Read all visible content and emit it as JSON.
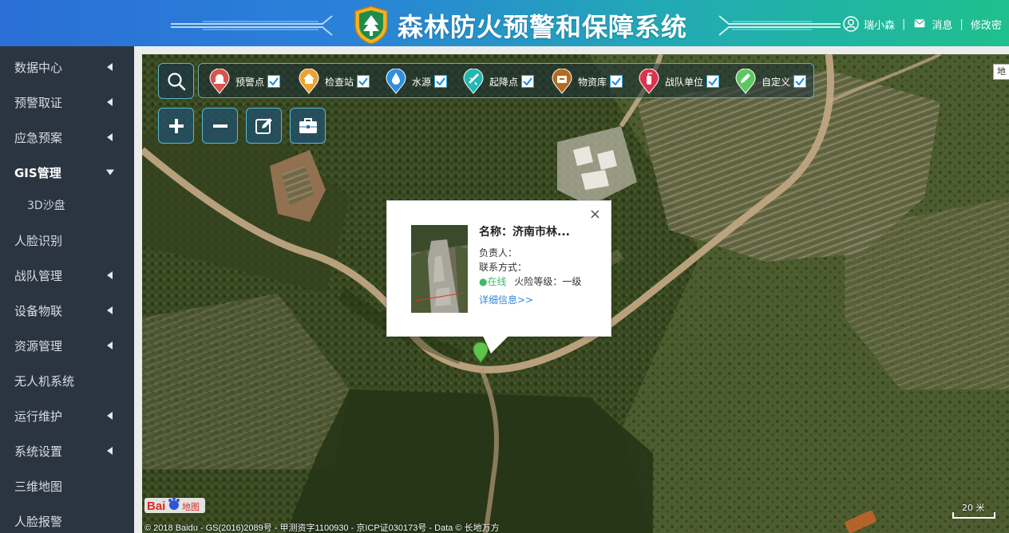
{
  "header": {
    "title": "森林防火预警和保障系统",
    "user_name": "瑞小森",
    "messages_label": "消息",
    "change_pwd_label": "修改密"
  },
  "sidebar": {
    "items": [
      {
        "label": "数据中心",
        "expandable": true
      },
      {
        "label": "预警取证",
        "expandable": true
      },
      {
        "label": "应急预案",
        "expandable": true
      },
      {
        "label": "GIS管理",
        "expandable": true,
        "open": true
      },
      {
        "label": "人脸识别",
        "expandable": false
      },
      {
        "label": "战队管理",
        "expandable": true
      },
      {
        "label": "设备物联",
        "expandable": true
      },
      {
        "label": "资源管理",
        "expandable": true
      },
      {
        "label": "无人机系统",
        "expandable": false
      },
      {
        "label": "运行维护",
        "expandable": true
      },
      {
        "label": "系统设置",
        "expandable": true
      },
      {
        "label": "三维地图",
        "expandable": false
      },
      {
        "label": "人脸报警",
        "expandable": false
      }
    ],
    "sub_items": [
      {
        "label": "3D沙盘"
      }
    ]
  },
  "map": {
    "layers": [
      {
        "label": "预警点",
        "icon": "alarm-icon",
        "color": "#d9534f",
        "checked": true
      },
      {
        "label": "检查站",
        "icon": "house-icon",
        "color": "#f0a030",
        "checked": true
      },
      {
        "label": "水源",
        "icon": "water-drop-icon",
        "color": "#2f8fe0",
        "checked": true
      },
      {
        "label": "起降点",
        "icon": "plane-icon",
        "color": "#20b8b0",
        "checked": true
      },
      {
        "label": "物资库",
        "icon": "box-icon",
        "color": "#b56a1f",
        "checked": true
      },
      {
        "label": "战队单位",
        "icon": "fire-extinguisher-icon",
        "color": "#e0324b",
        "checked": true
      },
      {
        "label": "自定义",
        "icon": "pencil-icon",
        "color": "#5cc860",
        "checked": true
      }
    ],
    "map_type_label": "地",
    "scale_label": "20 米",
    "copyright": "© 2018 Baidu - GS(2016)2089号 - 甲测资字1100930 - 京ICP证030173号 - Data © 长地万方",
    "baidu_text": "Bai",
    "baidu_text2": "地图"
  },
  "popup": {
    "name": "名称：济南市林...",
    "owner_label": "负责人：",
    "contact_label": "联系方式：",
    "status": "●在线",
    "fire_level": "火险等级：一级",
    "detail_link": "详细信息>>",
    "close_symbol": "×"
  },
  "colors": {
    "header_start": "#2a6fd6",
    "header_end": "#1fc08e",
    "sidebar_bg": "#2b3541",
    "online": "#3fb86a",
    "link": "#2f86d9"
  }
}
